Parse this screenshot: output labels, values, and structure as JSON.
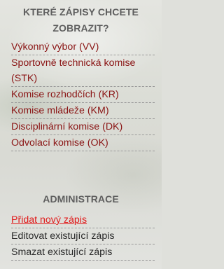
{
  "colors": {
    "link_red": "#8a1414",
    "active_link": "#e01a1a",
    "heading_gray": "#5e5e5e",
    "dark_text": "#2a2a2a"
  },
  "records_section": {
    "title_line1": "KTERÉ ZÁPISY CHCETE",
    "title_line2": "ZOBRAZIT?",
    "items": [
      {
        "label": "Výkonný výbor (VV)"
      },
      {
        "label": "Sportovně technická komise (STK)"
      },
      {
        "label": "Komise rozhodčích (KR)"
      },
      {
        "label": "Komise mládeže (KM)"
      },
      {
        "label": "Disciplinární komise (DK)"
      },
      {
        "label": "Odvolací komise (OK)"
      }
    ]
  },
  "admin_section": {
    "title": "ADMINISTRACE",
    "items": [
      {
        "label": "Přidat nový zápis",
        "active": true
      },
      {
        "label": "Editovat existující zápis",
        "active": false
      },
      {
        "label": "Smazat existující zápis",
        "active": false
      }
    ]
  }
}
